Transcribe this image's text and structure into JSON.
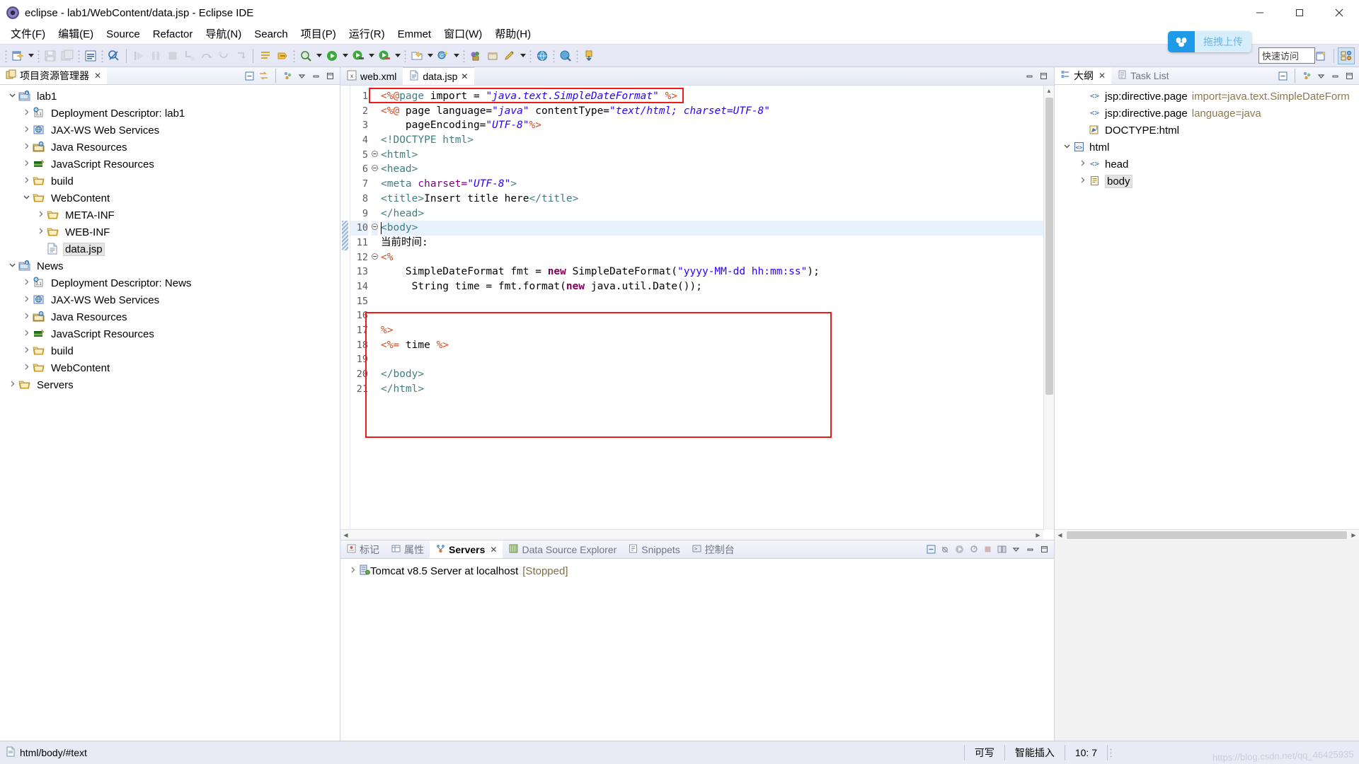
{
  "window": {
    "title": "eclipse - lab1/WebContent/data.jsp - Eclipse IDE",
    "app_icon": "eclipse-icon",
    "minimize": "minimize-button",
    "maximize": "maximize-button",
    "close": "close-button"
  },
  "menubar": {
    "items": [
      {
        "label": "文件(F)",
        "mnemonic": "F"
      },
      {
        "label": "编辑(E)",
        "mnemonic": "E"
      },
      {
        "label": "Source",
        "mnemonic": "S"
      },
      {
        "label": "Refactor",
        "mnemonic": "t"
      },
      {
        "label": "导航(N)",
        "mnemonic": "N"
      },
      {
        "label": "Search",
        "mnemonic": "a"
      },
      {
        "label": "项目(P)",
        "mnemonic": "P"
      },
      {
        "label": "运行(R)",
        "mnemonic": "R"
      },
      {
        "label": "Emmet",
        "mnemonic": ""
      },
      {
        "label": "窗口(W)",
        "mnemonic": "W"
      },
      {
        "label": "帮助(H)",
        "mnemonic": "H"
      }
    ]
  },
  "toolbar": {
    "upload_badge": "拖拽上传",
    "quick_access": "快速访问",
    "buttons": [
      "new-wizard-button",
      "save-button",
      "save-all-button",
      "print-button",
      "toggle-comment-button",
      "debug-skip-button",
      "resume-button",
      "suspend-button",
      "terminate-button",
      "step-into-button",
      "step-over-button",
      "step-return-button",
      "drop-to-frame-button",
      "open-type-button",
      "search-button",
      "debug-button",
      "run-button",
      "run-external-tools-button",
      "new-java-project-button",
      "new-class-button",
      "new-annotation-button",
      "open-browser-button",
      "open-web-browser-button",
      "download-button"
    ]
  },
  "project_explorer": {
    "title": "项目资源管理器",
    "tab_close": "×",
    "toolbar_icons": [
      "collapse-all-icon",
      "link-with-editor-icon",
      "view-menu-icon",
      "minimize-icon",
      "maximize-icon"
    ],
    "tree": [
      {
        "label": "lab1",
        "icon": "project-icon",
        "depth": 0,
        "twist": "open",
        "selected": false
      },
      {
        "label": "Deployment Descriptor: lab1",
        "icon": "deployment-descriptor-icon",
        "depth": 1,
        "twist": "closed",
        "selected": false
      },
      {
        "label": "JAX-WS Web Services",
        "icon": "jaxws-icon",
        "depth": 1,
        "twist": "closed",
        "selected": false
      },
      {
        "label": "Java Resources",
        "icon": "java-resources-icon",
        "depth": 1,
        "twist": "closed",
        "selected": false
      },
      {
        "label": "JavaScript Resources",
        "icon": "javascript-resources-icon",
        "depth": 1,
        "twist": "closed",
        "selected": false
      },
      {
        "label": "build",
        "icon": "folder-icon",
        "depth": 1,
        "twist": "closed",
        "selected": false
      },
      {
        "label": "WebContent",
        "icon": "folder-icon",
        "depth": 1,
        "twist": "open",
        "selected": false
      },
      {
        "label": "META-INF",
        "icon": "folder-icon",
        "depth": 2,
        "twist": "closed",
        "selected": false
      },
      {
        "label": "WEB-INF",
        "icon": "folder-icon",
        "depth": 2,
        "twist": "closed",
        "selected": false
      },
      {
        "label": "data.jsp",
        "icon": "jsp-file-icon",
        "depth": 2,
        "twist": "none",
        "selected": true
      },
      {
        "label": "News",
        "icon": "project-icon",
        "depth": 0,
        "twist": "open",
        "selected": false
      },
      {
        "label": "Deployment Descriptor: News",
        "icon": "deployment-descriptor-icon",
        "depth": 1,
        "twist": "closed",
        "selected": false
      },
      {
        "label": "JAX-WS Web Services",
        "icon": "jaxws-icon",
        "depth": 1,
        "twist": "closed",
        "selected": false
      },
      {
        "label": "Java Resources",
        "icon": "java-resources-icon",
        "depth": 1,
        "twist": "closed",
        "selected": false
      },
      {
        "label": "JavaScript Resources",
        "icon": "javascript-resources-icon",
        "depth": 1,
        "twist": "closed",
        "selected": false
      },
      {
        "label": "build",
        "icon": "folder-icon",
        "depth": 1,
        "twist": "closed",
        "selected": false
      },
      {
        "label": "WebContent",
        "icon": "folder-icon",
        "depth": 1,
        "twist": "closed",
        "selected": false
      },
      {
        "label": "Servers",
        "icon": "folder-icon",
        "depth": 0,
        "twist": "closed",
        "selected": false
      }
    ]
  },
  "editor": {
    "tabs": [
      {
        "label": "web.xml",
        "icon": "xml-file-icon",
        "active": false,
        "closable": false
      },
      {
        "label": "data.jsp",
        "icon": "jsp-file-icon",
        "active": true,
        "closable": true
      }
    ],
    "toolbar_icons": [
      "minimize-icon",
      "maximize-icon"
    ],
    "first_line_number": 1,
    "lines": [
      {
        "n": 1,
        "fold": "",
        "highlight": false,
        "tokens": [
          {
            "t": "<%@",
            "c": "s-jsp"
          },
          {
            "t": "page",
            "c": "s-jspk"
          },
          {
            "t": " import = ",
            "c": "s-plain"
          },
          {
            "t": "\"java.text.SimpleDateFormat\"",
            "c": "s-str"
          },
          {
            "t": " ",
            "c": "s-plain"
          },
          {
            "t": "%>",
            "c": "s-jsp"
          }
        ]
      },
      {
        "n": 2,
        "fold": "",
        "highlight": false,
        "tokens": [
          {
            "t": "<%@",
            "c": "s-jsp"
          },
          {
            "t": " page language=",
            "c": "s-plain"
          },
          {
            "t": "\"java\"",
            "c": "s-str"
          },
          {
            "t": " contentType=",
            "c": "s-plain"
          },
          {
            "t": "\"text/html; charset=UTF-8\"",
            "c": "s-str"
          }
        ]
      },
      {
        "n": 3,
        "fold": "",
        "highlight": false,
        "tokens": [
          {
            "t": "    pageEncoding=",
            "c": "s-plain"
          },
          {
            "t": "\"UTF-8\"",
            "c": "s-str"
          },
          {
            "t": "%>",
            "c": "s-jsp"
          }
        ]
      },
      {
        "n": 4,
        "fold": "",
        "highlight": false,
        "tokens": [
          {
            "t": "<!DOCTYPE html>",
            "c": "s-tagn"
          }
        ]
      },
      {
        "n": 5,
        "fold": "-",
        "highlight": false,
        "tokens": [
          {
            "t": "<html>",
            "c": "s-tagn"
          }
        ]
      },
      {
        "n": 6,
        "fold": "-",
        "highlight": false,
        "tokens": [
          {
            "t": "<head>",
            "c": "s-tagn"
          }
        ]
      },
      {
        "n": 7,
        "fold": "",
        "highlight": false,
        "tokens": [
          {
            "t": "<meta ",
            "c": "s-tagn"
          },
          {
            "t": "charset=",
            "c": "s-attr"
          },
          {
            "t": "\"UTF-8\"",
            "c": "s-str"
          },
          {
            "t": ">",
            "c": "s-tagn"
          }
        ]
      },
      {
        "n": 8,
        "fold": "",
        "highlight": false,
        "tokens": [
          {
            "t": "<title>",
            "c": "s-tagn"
          },
          {
            "t": "Insert title here",
            "c": "s-txt"
          },
          {
            "t": "</title>",
            "c": "s-tagn"
          }
        ]
      },
      {
        "n": 9,
        "fold": "",
        "highlight": false,
        "tokens": [
          {
            "t": "</head>",
            "c": "s-tagn"
          }
        ]
      },
      {
        "n": 10,
        "fold": "-",
        "highlight": true,
        "tokens": [
          {
            "t": "<body>",
            "c": "s-tagn"
          }
        ]
      },
      {
        "n": 11,
        "fold": "",
        "highlight": false,
        "tokens": [
          {
            "t": "当前时间:",
            "c": "s-txt"
          }
        ]
      },
      {
        "n": 12,
        "fold": "-",
        "highlight": false,
        "tokens": [
          {
            "t": "<%",
            "c": "s-jsp"
          }
        ]
      },
      {
        "n": 13,
        "fold": "",
        "highlight": false,
        "tokens": [
          {
            "t": "    SimpleDateFormat fmt = ",
            "c": "s-plain"
          },
          {
            "t": "new",
            "c": "s-kw"
          },
          {
            "t": " SimpleDateFormat(",
            "c": "s-plain"
          },
          {
            "t": "\"yyyy-MM-dd hh:mm:ss\"",
            "c": "s-str2"
          },
          {
            "t": ");",
            "c": "s-plain"
          }
        ]
      },
      {
        "n": 14,
        "fold": "",
        "highlight": false,
        "tokens": [
          {
            "t": "     String time = fmt.format(",
            "c": "s-plain"
          },
          {
            "t": "new",
            "c": "s-kw"
          },
          {
            "t": " java.util.Date());",
            "c": "s-plain"
          }
        ]
      },
      {
        "n": 15,
        "fold": "",
        "highlight": false,
        "tokens": []
      },
      {
        "n": 16,
        "fold": "",
        "highlight": false,
        "tokens": []
      },
      {
        "n": 17,
        "fold": "",
        "highlight": false,
        "tokens": [
          {
            "t": "%>",
            "c": "s-jsp"
          }
        ]
      },
      {
        "n": 18,
        "fold": "",
        "highlight": false,
        "tokens": [
          {
            "t": "<%= ",
            "c": "s-jsp"
          },
          {
            "t": "time",
            "c": "s-plain"
          },
          {
            "t": " %>",
            "c": "s-jsp"
          }
        ]
      },
      {
        "n": 19,
        "fold": "",
        "highlight": false,
        "tokens": []
      },
      {
        "n": 20,
        "fold": "",
        "highlight": false,
        "tokens": [
          {
            "t": "</body>",
            "c": "s-tagn"
          }
        ]
      },
      {
        "n": 21,
        "fold": "",
        "highlight": false,
        "tokens": [
          {
            "t": "</html>",
            "c": "s-tagn"
          }
        ]
      }
    ]
  },
  "outline": {
    "tabs": [
      {
        "label": "大纲",
        "icon": "outline-icon",
        "active": true,
        "closable": true
      },
      {
        "label": "Task List",
        "icon": "task-list-icon",
        "active": false,
        "closable": false
      }
    ],
    "toolbar_icons": [
      "collapse-all-icon",
      "view-menu-icon",
      "minimize-icon",
      "maximize-icon"
    ],
    "nodes": [
      {
        "label": "jsp:directive.page",
        "attr": "import=java.text.SimpleDateForm",
        "icon": "element-icon",
        "depth": 1,
        "twist": "none",
        "selected": false
      },
      {
        "label": "jsp:directive.page",
        "attr": "language=java",
        "icon": "element-icon",
        "depth": 1,
        "twist": "none",
        "selected": false
      },
      {
        "label": "DOCTYPE:html",
        "attr": "",
        "icon": "doctype-icon",
        "depth": 1,
        "twist": "none",
        "selected": false
      },
      {
        "label": "html",
        "attr": "",
        "icon": "html-element-icon",
        "depth": 0,
        "twist": "open",
        "selected": false
      },
      {
        "label": "head",
        "attr": "",
        "icon": "element-icon",
        "depth": 1,
        "twist": "closed",
        "selected": false
      },
      {
        "label": "body",
        "attr": "",
        "icon": "body-element-icon",
        "depth": 1,
        "twist": "closed",
        "selected": true
      }
    ]
  },
  "bottom_panel": {
    "tabs": [
      {
        "label": "标记",
        "icon": "markers-icon",
        "active": false,
        "closable": false
      },
      {
        "label": "属性",
        "icon": "properties-icon",
        "active": false,
        "closable": false
      },
      {
        "label": "Servers",
        "icon": "servers-icon",
        "active": true,
        "closable": true
      },
      {
        "label": "Data Source Explorer",
        "icon": "data-source-icon",
        "active": false,
        "closable": false
      },
      {
        "label": "Snippets",
        "icon": "snippets-icon",
        "active": false,
        "closable": false
      },
      {
        "label": "控制台",
        "icon": "console-icon",
        "active": false,
        "closable": false
      }
    ],
    "toolbar_icons": [
      "new-server-icon",
      "debug-server-icon",
      "start-server-icon",
      "profile-server-icon",
      "stop-server-icon",
      "publish-icon",
      "view-menu-icon",
      "minimize-icon",
      "maximize-icon"
    ],
    "rows": [
      {
        "label": "Tomcat v8.5 Server at localhost",
        "status": "[Stopped]",
        "icon": "server-icon",
        "twist": "closed"
      }
    ]
  },
  "statusbar": {
    "path": "html/body/#text",
    "path_icon": "file-icon",
    "writable": "可写",
    "insert_mode": "智能插入",
    "position": "10: 7",
    "watermark": "https://blog.csdn.net/qq_46425935"
  },
  "colors": {
    "toolbar_bg": "#e6e9f5",
    "accent_red": "#ee1b1b",
    "tab_active_bg": "#ffffff",
    "selection_bg": "#e4e4e4",
    "highlight_line": "#e8f2fe",
    "upload_badge_blue": "#1e9ae8",
    "string_blue": "#2a00ff",
    "jsp_orange": "#c9532a",
    "tag_teal": "#3f7f7f",
    "keyword_purple": "#7f0055",
    "attr_purple": "#7f007f"
  }
}
